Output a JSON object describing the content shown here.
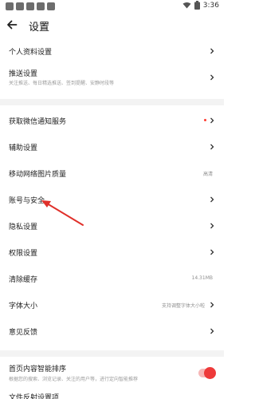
{
  "statusbar": {
    "time": "3:36"
  },
  "header": {
    "title": "设置"
  },
  "rows": {
    "profile": {
      "title": "个人资料设置"
    },
    "push": {
      "title": "推送设置",
      "subtitle": "关注推送、每日精选推送、签到提醒、安静时段等"
    },
    "wechat": {
      "title": "获取微信通知服务"
    },
    "assist": {
      "title": "辅助设置"
    },
    "network_image": {
      "title": "移动网络图片质量",
      "value": "高清"
    },
    "account": {
      "title": "账号与安全"
    },
    "privacy": {
      "title": "隐私设置"
    },
    "permission": {
      "title": "权限设置"
    },
    "cache": {
      "title": "清除缓存",
      "value": "14.31MB"
    },
    "font": {
      "title": "字体大小",
      "value": "支持调整字体大小啦"
    },
    "feedback": {
      "title": "意见反馈"
    },
    "smart_sort": {
      "title": "首页内容智能排序",
      "subtitle": "根据您的搜索、浏览记录、关注的用户等，进行定向智能推荐",
      "enabled": true
    },
    "partial": {
      "title": "文件反射设置项"
    }
  },
  "colors": {
    "accent": "#ee3a3a",
    "arrow": "#e0302a",
    "separator": "#f3f3f3"
  },
  "icons": {
    "back": "back-arrow-icon",
    "chevron": "chevron-right-icon",
    "wifi": "wifi-icon",
    "battery": "battery-icon"
  }
}
